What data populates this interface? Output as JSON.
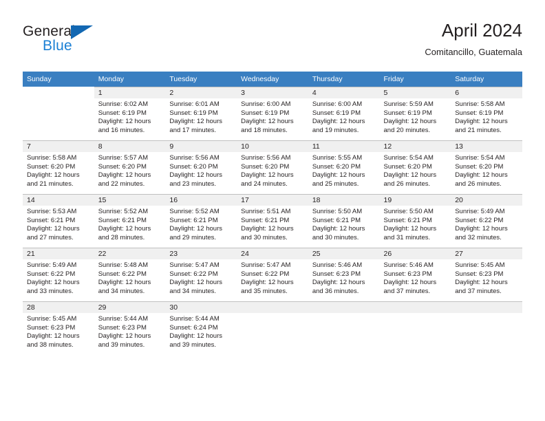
{
  "brand": {
    "name_part1": "General",
    "name_part2": "Blue",
    "triangle_color": "#1267b2",
    "blue_color": "#1a7fd4"
  },
  "header": {
    "title": "April 2024",
    "subtitle": "Comitancillo, Guatemala"
  },
  "theme": {
    "header_bar_color": "#3a7fc1",
    "daynum_bar_color": "#f0f0f0",
    "text_color": "#231f20"
  },
  "weekdays": [
    "Sunday",
    "Monday",
    "Tuesday",
    "Wednesday",
    "Thursday",
    "Friday",
    "Saturday"
  ],
  "labels": {
    "sunrise_prefix": "Sunrise: ",
    "sunset_prefix": "Sunset: ",
    "daylight_prefix": "Daylight: "
  },
  "weeks": [
    [
      {
        "blank": true
      },
      {
        "day": "1",
        "sunrise": "Sunrise: 6:02 AM",
        "sunset": "Sunset: 6:19 PM",
        "daylight": "Daylight: 12 hours and 16 minutes."
      },
      {
        "day": "2",
        "sunrise": "Sunrise: 6:01 AM",
        "sunset": "Sunset: 6:19 PM",
        "daylight": "Daylight: 12 hours and 17 minutes."
      },
      {
        "day": "3",
        "sunrise": "Sunrise: 6:00 AM",
        "sunset": "Sunset: 6:19 PM",
        "daylight": "Daylight: 12 hours and 18 minutes."
      },
      {
        "day": "4",
        "sunrise": "Sunrise: 6:00 AM",
        "sunset": "Sunset: 6:19 PM",
        "daylight": "Daylight: 12 hours and 19 minutes."
      },
      {
        "day": "5",
        "sunrise": "Sunrise: 5:59 AM",
        "sunset": "Sunset: 6:19 PM",
        "daylight": "Daylight: 12 hours and 20 minutes."
      },
      {
        "day": "6",
        "sunrise": "Sunrise: 5:58 AM",
        "sunset": "Sunset: 6:19 PM",
        "daylight": "Daylight: 12 hours and 21 minutes."
      }
    ],
    [
      {
        "day": "7",
        "sunrise": "Sunrise: 5:58 AM",
        "sunset": "Sunset: 6:20 PM",
        "daylight": "Daylight: 12 hours and 21 minutes."
      },
      {
        "day": "8",
        "sunrise": "Sunrise: 5:57 AM",
        "sunset": "Sunset: 6:20 PM",
        "daylight": "Daylight: 12 hours and 22 minutes."
      },
      {
        "day": "9",
        "sunrise": "Sunrise: 5:56 AM",
        "sunset": "Sunset: 6:20 PM",
        "daylight": "Daylight: 12 hours and 23 minutes."
      },
      {
        "day": "10",
        "sunrise": "Sunrise: 5:56 AM",
        "sunset": "Sunset: 6:20 PM",
        "daylight": "Daylight: 12 hours and 24 minutes."
      },
      {
        "day": "11",
        "sunrise": "Sunrise: 5:55 AM",
        "sunset": "Sunset: 6:20 PM",
        "daylight": "Daylight: 12 hours and 25 minutes."
      },
      {
        "day": "12",
        "sunrise": "Sunrise: 5:54 AM",
        "sunset": "Sunset: 6:20 PM",
        "daylight": "Daylight: 12 hours and 26 minutes."
      },
      {
        "day": "13",
        "sunrise": "Sunrise: 5:54 AM",
        "sunset": "Sunset: 6:20 PM",
        "daylight": "Daylight: 12 hours and 26 minutes."
      }
    ],
    [
      {
        "day": "14",
        "sunrise": "Sunrise: 5:53 AM",
        "sunset": "Sunset: 6:21 PM",
        "daylight": "Daylight: 12 hours and 27 minutes."
      },
      {
        "day": "15",
        "sunrise": "Sunrise: 5:52 AM",
        "sunset": "Sunset: 6:21 PM",
        "daylight": "Daylight: 12 hours and 28 minutes."
      },
      {
        "day": "16",
        "sunrise": "Sunrise: 5:52 AM",
        "sunset": "Sunset: 6:21 PM",
        "daylight": "Daylight: 12 hours and 29 minutes."
      },
      {
        "day": "17",
        "sunrise": "Sunrise: 5:51 AM",
        "sunset": "Sunset: 6:21 PM",
        "daylight": "Daylight: 12 hours and 30 minutes."
      },
      {
        "day": "18",
        "sunrise": "Sunrise: 5:50 AM",
        "sunset": "Sunset: 6:21 PM",
        "daylight": "Daylight: 12 hours and 30 minutes."
      },
      {
        "day": "19",
        "sunrise": "Sunrise: 5:50 AM",
        "sunset": "Sunset: 6:21 PM",
        "daylight": "Daylight: 12 hours and 31 minutes."
      },
      {
        "day": "20",
        "sunrise": "Sunrise: 5:49 AM",
        "sunset": "Sunset: 6:22 PM",
        "daylight": "Daylight: 12 hours and 32 minutes."
      }
    ],
    [
      {
        "day": "21",
        "sunrise": "Sunrise: 5:49 AM",
        "sunset": "Sunset: 6:22 PM",
        "daylight": "Daylight: 12 hours and 33 minutes."
      },
      {
        "day": "22",
        "sunrise": "Sunrise: 5:48 AM",
        "sunset": "Sunset: 6:22 PM",
        "daylight": "Daylight: 12 hours and 34 minutes."
      },
      {
        "day": "23",
        "sunrise": "Sunrise: 5:47 AM",
        "sunset": "Sunset: 6:22 PM",
        "daylight": "Daylight: 12 hours and 34 minutes."
      },
      {
        "day": "24",
        "sunrise": "Sunrise: 5:47 AM",
        "sunset": "Sunset: 6:22 PM",
        "daylight": "Daylight: 12 hours and 35 minutes."
      },
      {
        "day": "25",
        "sunrise": "Sunrise: 5:46 AM",
        "sunset": "Sunset: 6:23 PM",
        "daylight": "Daylight: 12 hours and 36 minutes."
      },
      {
        "day": "26",
        "sunrise": "Sunrise: 5:46 AM",
        "sunset": "Sunset: 6:23 PM",
        "daylight": "Daylight: 12 hours and 37 minutes."
      },
      {
        "day": "27",
        "sunrise": "Sunrise: 5:45 AM",
        "sunset": "Sunset: 6:23 PM",
        "daylight": "Daylight: 12 hours and 37 minutes."
      }
    ],
    [
      {
        "day": "28",
        "sunrise": "Sunrise: 5:45 AM",
        "sunset": "Sunset: 6:23 PM",
        "daylight": "Daylight: 12 hours and 38 minutes."
      },
      {
        "day": "29",
        "sunrise": "Sunrise: 5:44 AM",
        "sunset": "Sunset: 6:23 PM",
        "daylight": "Daylight: 12 hours and 39 minutes."
      },
      {
        "day": "30",
        "sunrise": "Sunrise: 5:44 AM",
        "sunset": "Sunset: 6:24 PM",
        "daylight": "Daylight: 12 hours and 39 minutes."
      },
      {
        "empty": true
      },
      {
        "empty": true
      },
      {
        "empty": true
      },
      {
        "empty": true
      }
    ]
  ]
}
